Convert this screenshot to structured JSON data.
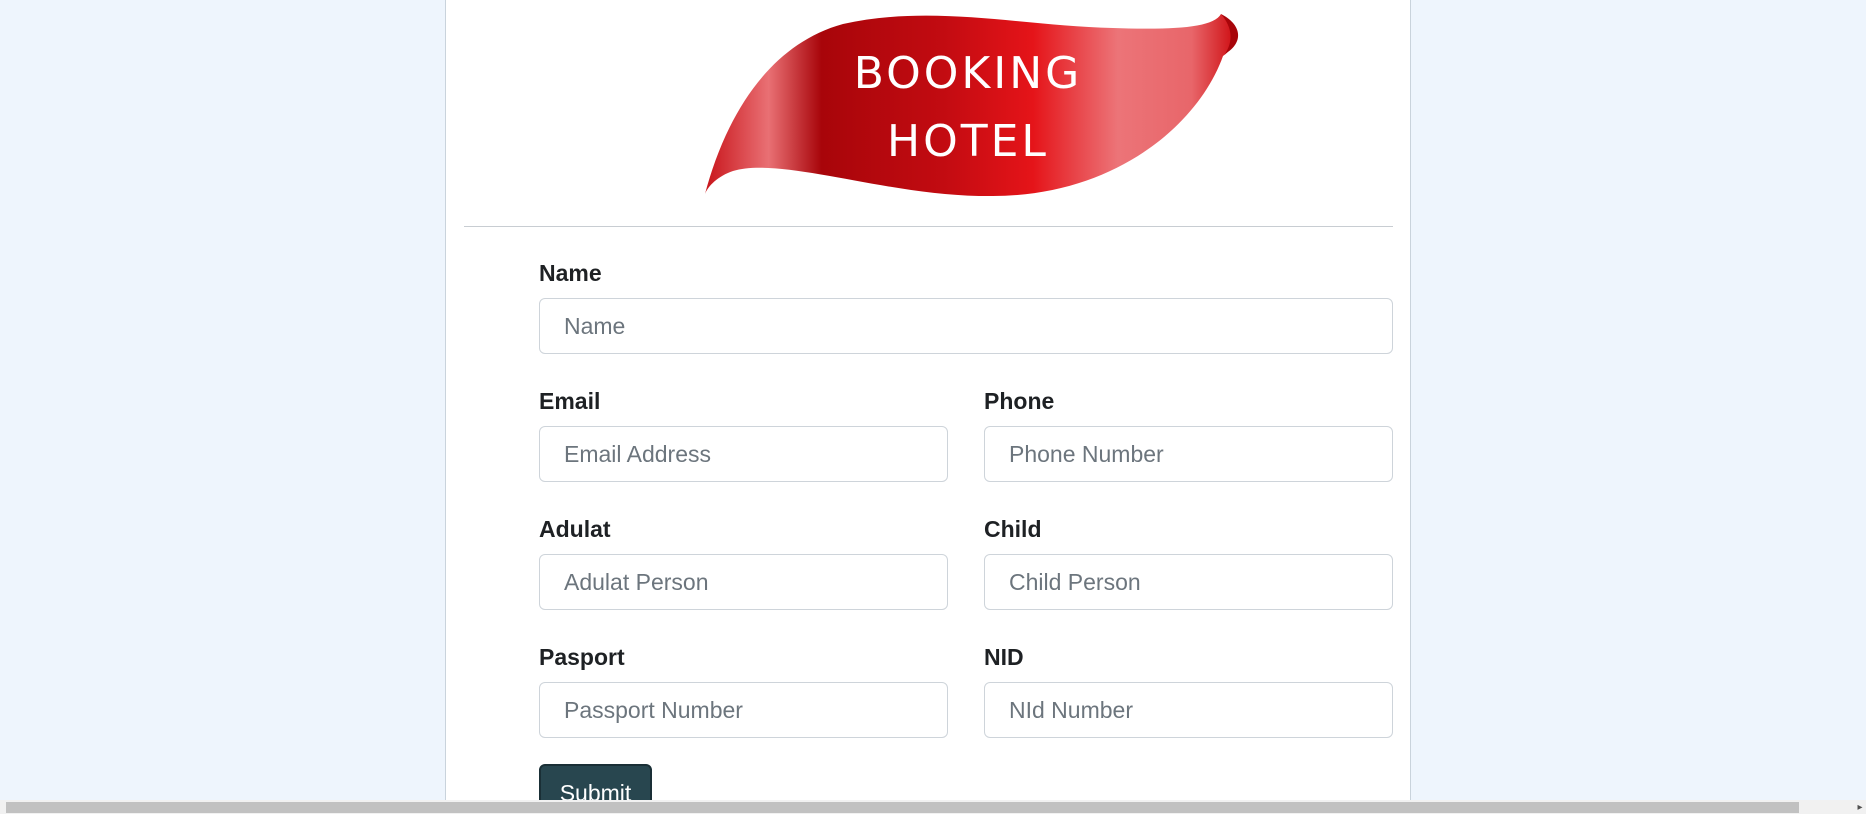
{
  "logo": {
    "line1": "BOOKING",
    "line2": "HOTEL",
    "ribbon_color": "#d4181c",
    "text_color": "#ffffff"
  },
  "form": {
    "fields": {
      "name": {
        "label": "Name",
        "placeholder": "Name",
        "value": ""
      },
      "email": {
        "label": "Email",
        "placeholder": "Email Address",
        "value": ""
      },
      "phone": {
        "label": "Phone",
        "placeholder": "Phone Number",
        "value": ""
      },
      "adult": {
        "label": "Adulat",
        "placeholder": "Adulat Person",
        "value": ""
      },
      "child": {
        "label": "Child",
        "placeholder": "Child Person",
        "value": ""
      },
      "passport": {
        "label": "Pasport",
        "placeholder": "Passport Number",
        "value": ""
      },
      "nid": {
        "label": "NID",
        "placeholder": "NId Number",
        "value": ""
      }
    },
    "submit_label": "Submit"
  },
  "colors": {
    "page_background": "#eef5fd",
    "card_background": "#ffffff",
    "submit_background": "#28464f"
  },
  "icons": {
    "scroll_right": "right-arrow-icon"
  }
}
